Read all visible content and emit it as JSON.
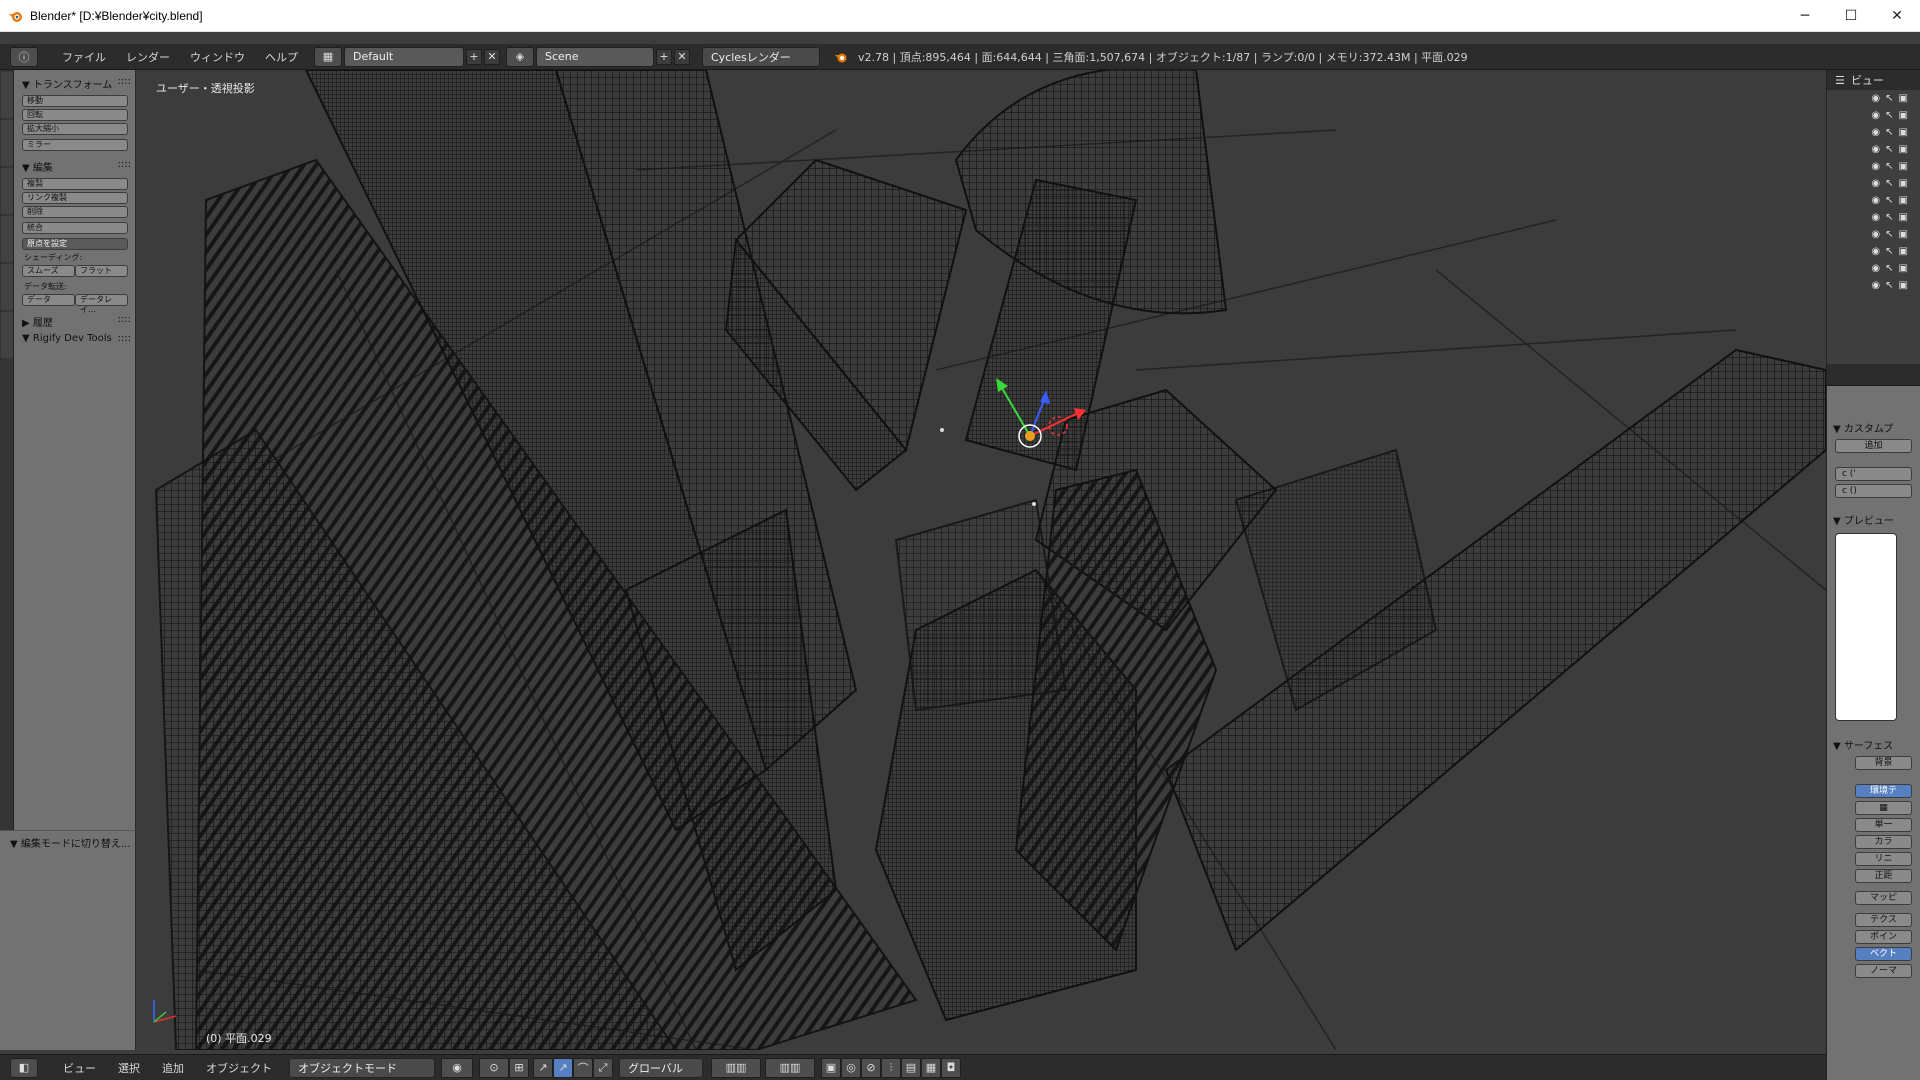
{
  "window": {
    "title": "Blender* [D:¥Blender¥city.blend]",
    "minimize": "─",
    "maximize": "☐",
    "close": "✕"
  },
  "info_header": {
    "menus": [
      "ファイル",
      "レンダー",
      "ウィンドウ",
      "ヘルプ"
    ],
    "screen_layout": "Default",
    "scene": "Scene",
    "render_engine": "Cyclesレンダー",
    "stats": "v2.78 | 頂点:895,464 | 面:644,644 | 三角面:1,507,674 | オブジェクト:1/87 | ランプ:0/0 | メモリ:372.43M | 平面.029"
  },
  "tool_shelf": {
    "transform": {
      "title": "トランスフォーム",
      "buttons": [
        "移動",
        "回転",
        "拡大縮小",
        "ミラー"
      ]
    },
    "edit": {
      "title": "編集",
      "buttons": [
        "複製",
        "リンク複製",
        "削除",
        "統合"
      ],
      "origin": "原点を設定",
      "shading_label": "シェーディング:",
      "smooth": "スムーズ",
      "flat": "フラット",
      "data_transfer_label": "データ転送:",
      "data": "データ",
      "data_layout": "データレイ..."
    },
    "history": {
      "title": "履歴"
    },
    "rigify": {
      "title": "Rigify Dev Tools"
    }
  },
  "operator_panel": {
    "title": "編集モードに切り替え..."
  },
  "viewport": {
    "view_name": "ユーザー・透視投影",
    "object_info": "(0) 平面.029"
  },
  "outliner": {
    "header": "ビュー",
    "row_count": 12
  },
  "properties": {
    "custom_props": "カスタムプ",
    "add": "追加",
    "row1": "c  (' ",
    "row2": "c  ()",
    "preview": "プレビュー",
    "surface": "サーフェス",
    "surface_btn": "背景",
    "env_btn": "環境テ",
    "items": [
      "単一",
      "カラ",
      "リニ",
      "正距",
      "マッピ"
    ],
    "tex_items": [
      "テクス",
      "ポイン",
      "ベクト",
      "ノーマ"
    ]
  },
  "bottom_header": {
    "menus": [
      "ビュー",
      "選択",
      "追加",
      "オブジェクト"
    ],
    "mode": "オブジェクトモード",
    "orientation": "グローバル"
  },
  "colors": {
    "viewport_bg": "#3c3c3c",
    "header_bg": "#2c2c2c",
    "panel_bg": "#727272",
    "accent_blue": "#5680c2"
  }
}
